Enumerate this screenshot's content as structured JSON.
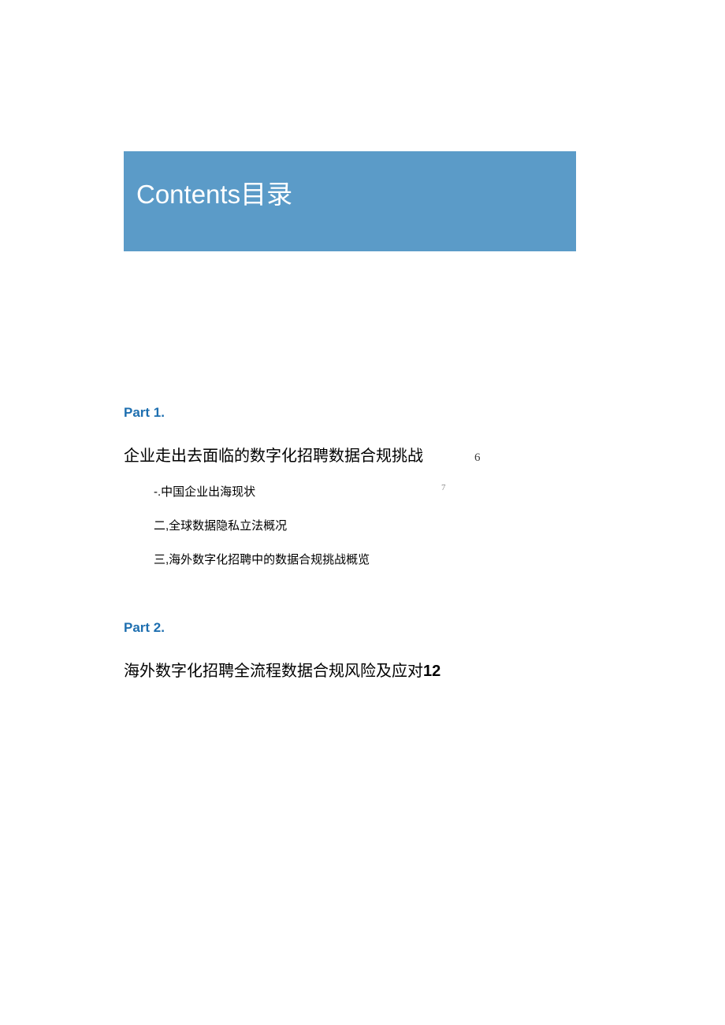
{
  "header": {
    "title": "Contents目录"
  },
  "part1": {
    "label": "Part 1.",
    "title": "企业走出去面临的数字化招聘数据合规挑战",
    "page": "6",
    "items": [
      {
        "text": "-.中国企业出海现状",
        "page": "7"
      },
      {
        "text": "二,全球数据隐私立法概况",
        "page": ""
      },
      {
        "text": "三,海外数字化招聘中的数据合规挑战概览",
        "page": ""
      }
    ]
  },
  "part2": {
    "label": "Part 2.",
    "title": "海外数字化招聘全流程数据合规风险及应对",
    "page": "12"
  }
}
